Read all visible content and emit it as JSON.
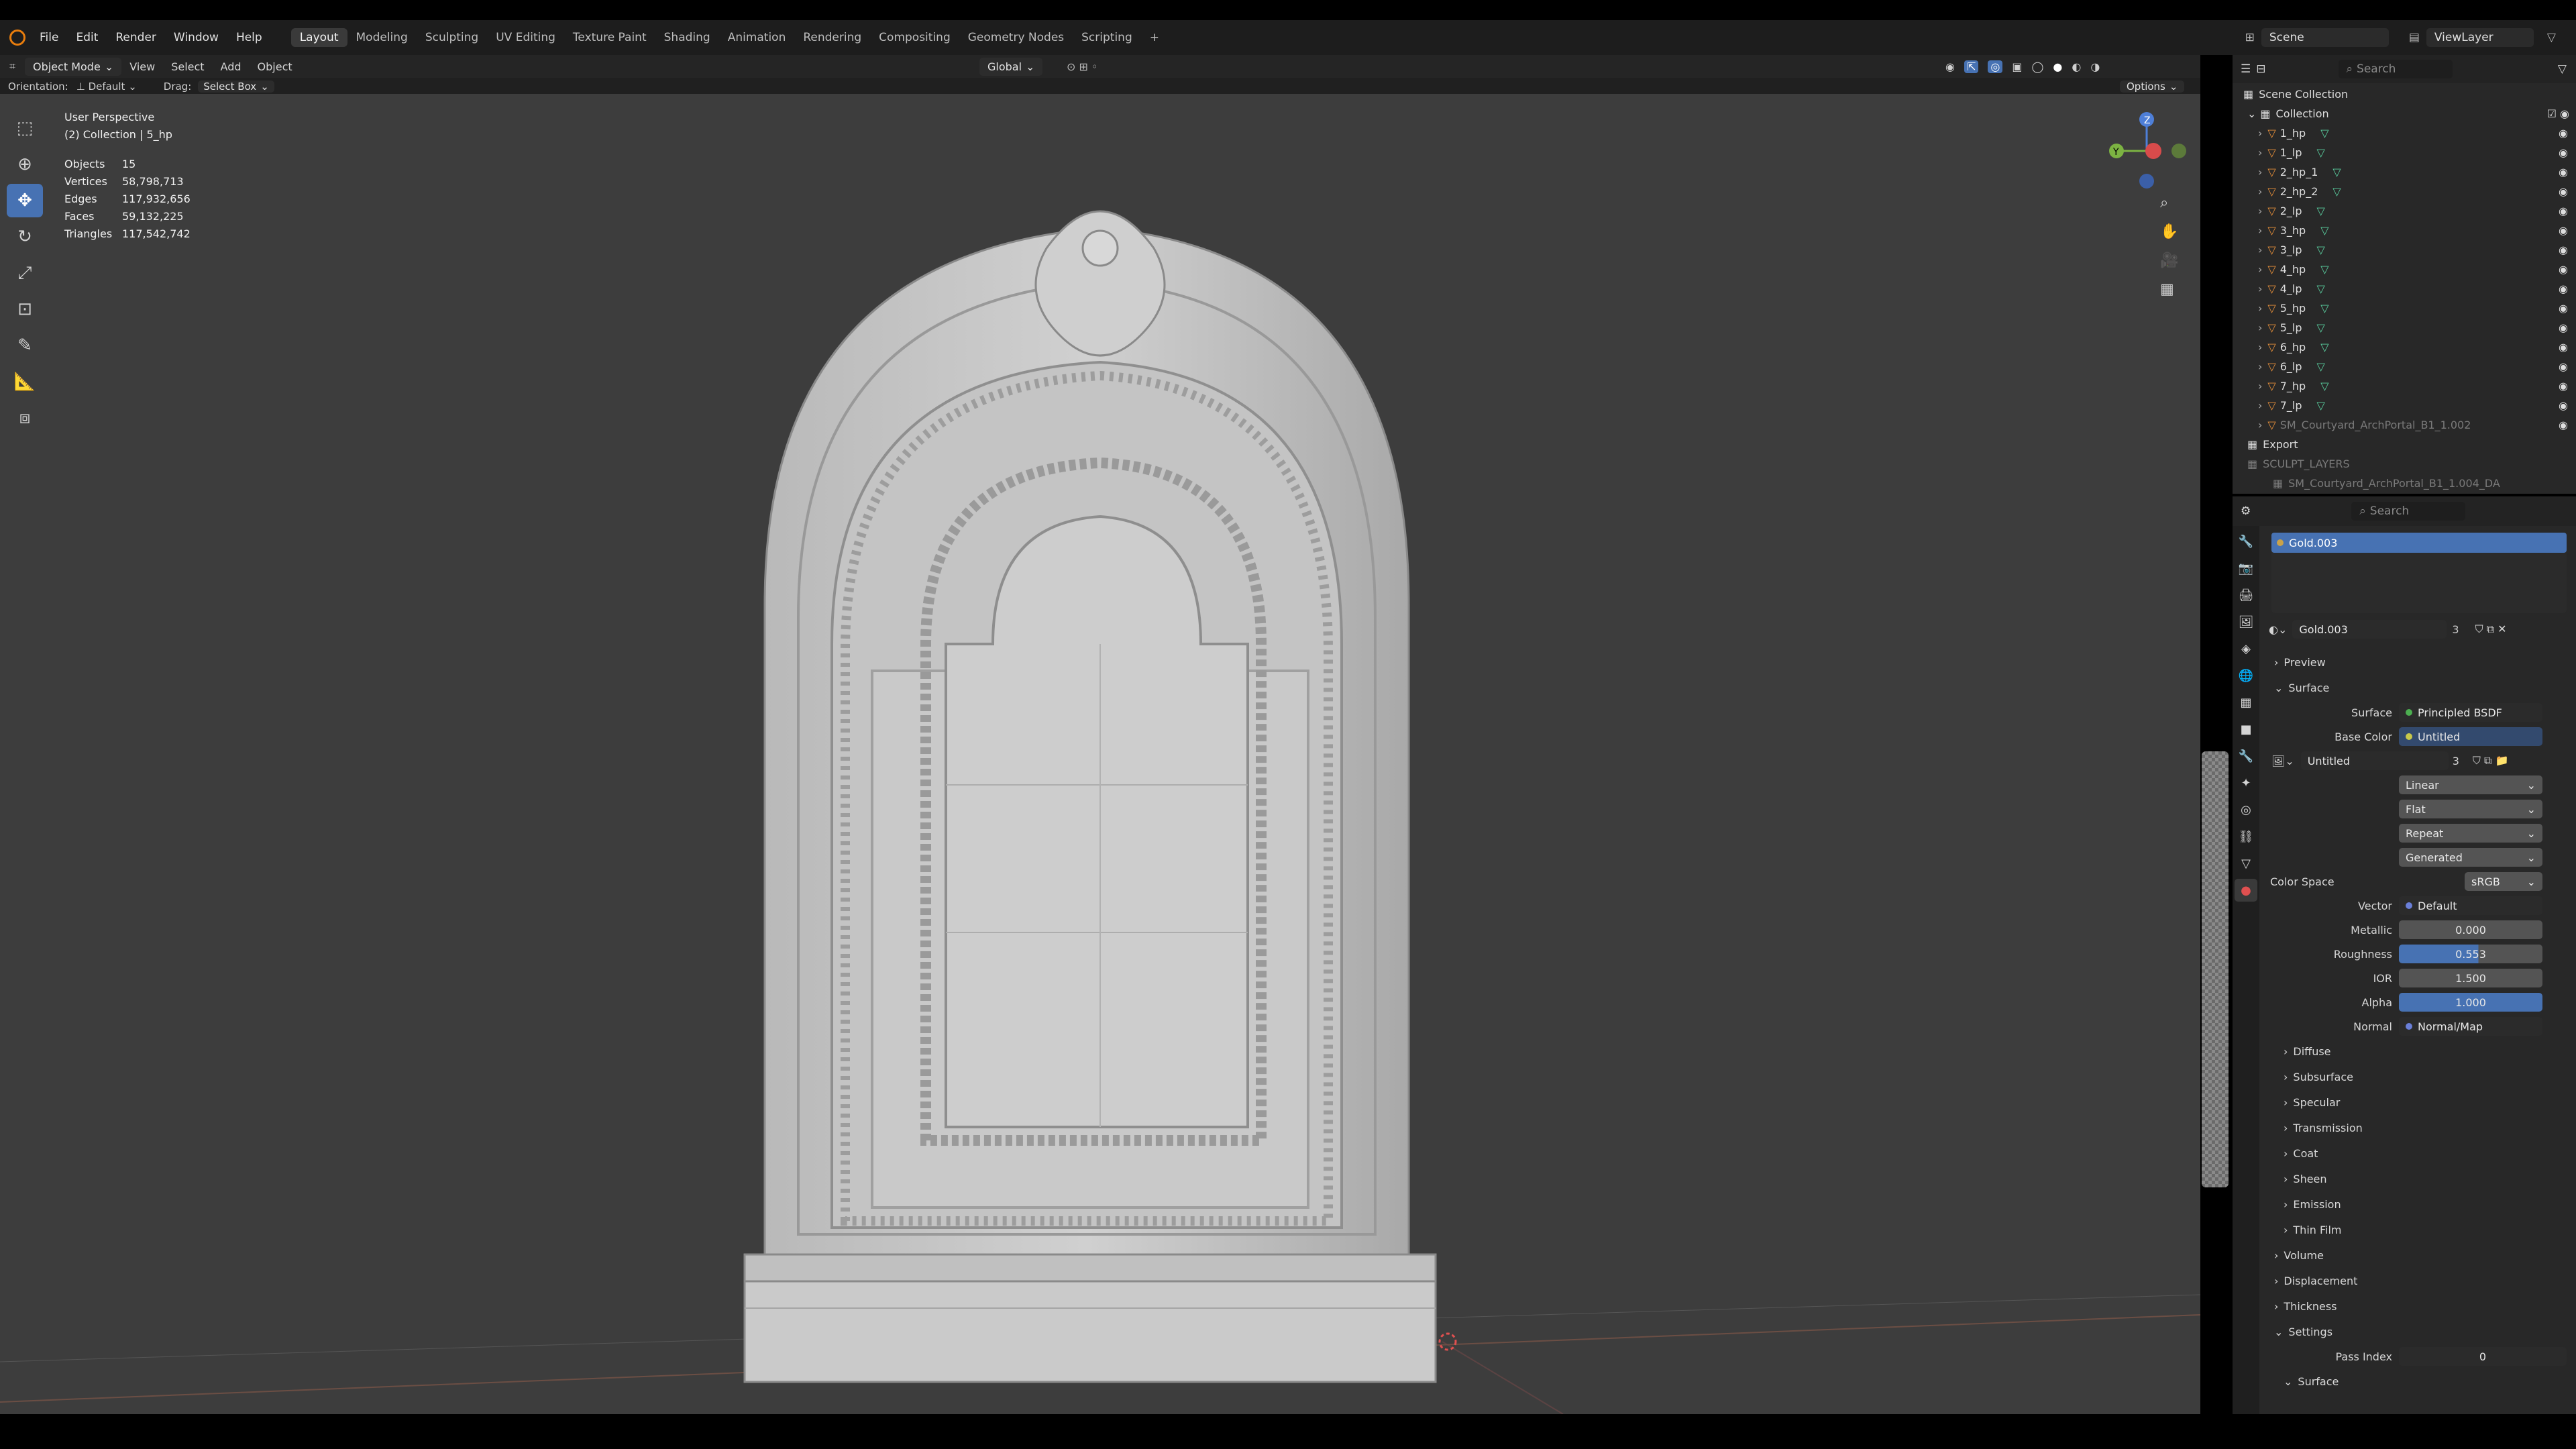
{
  "topbar": {
    "menus": [
      "File",
      "Edit",
      "Render",
      "Window",
      "Help"
    ],
    "workspaces": [
      "Layout",
      "Modeling",
      "Sculpting",
      "UV Editing",
      "Texture Paint",
      "Shading",
      "Animation",
      "Rendering",
      "Compositing",
      "Geometry Nodes",
      "Scripting"
    ],
    "active_workspace": "Layout",
    "add": "+",
    "scene": "Scene",
    "viewlayer": "ViewLayer"
  },
  "header": {
    "mode": "Object Mode",
    "view": "View",
    "select": "Select",
    "add": "Add",
    "object": "Object",
    "transform": "Global",
    "options": "Options",
    "orientation_label": "Orientation:",
    "orientation": "Default",
    "drag_label": "Drag:",
    "drag": "Select Box"
  },
  "viewport": {
    "perspective": "User Perspective",
    "collection": "(2) Collection | 5_hp",
    "stats": [
      {
        "k": "Objects",
        "v": "15"
      },
      {
        "k": "Vertices",
        "v": "58,798,713"
      },
      {
        "k": "Edges",
        "v": "117,932,656"
      },
      {
        "k": "Faces",
        "v": "59,132,225"
      },
      {
        "k": "Triangles",
        "v": "117,542,742"
      }
    ],
    "gizmo": {
      "z": "Z",
      "y": "Y"
    }
  },
  "outliner": {
    "search_placeholder": "Search",
    "root": "Scene Collection",
    "collection": "Collection",
    "items": [
      "1_hp",
      "1_lp",
      "2_hp_1",
      "2_hp_2",
      "2_lp",
      "3_hp",
      "3_lp",
      "4_hp",
      "4_lp",
      "5_hp",
      "5_lp",
      "6_hp",
      "6_lp",
      "7_hp",
      "7_lp",
      "SM_Courtyard_ArchPortal_B1_1.002"
    ],
    "export": "Export",
    "sculpt": "SCULPT_LAYERS",
    "sculpt_item": "SM_Courtyard_ArchPortal_B1_1.004_DA"
  },
  "props": {
    "search_placeholder": "Search",
    "slot": "Gold.003",
    "material": "Gold.003",
    "users": "3",
    "preview": "Preview",
    "surface_section": "Surface",
    "surface_label": "Surface",
    "surface_value": "Principled BSDF",
    "basecolor_label": "Base Color",
    "basecolor_value": "Untitled",
    "image": "Untitled",
    "image_users": "3",
    "interp": "Linear",
    "proj": "Flat",
    "ext": "Repeat",
    "source": "Generated",
    "colorspace_label": "Color Space",
    "colorspace": "sRGB",
    "vector_label": "Vector",
    "vector": "Default",
    "metallic_label": "Metallic",
    "metallic": "0.000",
    "roughness_label": "Roughness",
    "roughness": "0.553",
    "roughness_value": 0.553,
    "ior_label": "IOR",
    "ior": "1.500",
    "alpha_label": "Alpha",
    "alpha": "1.000",
    "alpha_value": 1.0,
    "normal_label": "Normal",
    "normal": "Normal/Map",
    "subsections": [
      "Diffuse",
      "Subsurface",
      "Specular",
      "Transmission",
      "Coat",
      "Sheen",
      "Emission",
      "Thin Film"
    ],
    "volume": "Volume",
    "displacement": "Displacement",
    "thickness": "Thickness",
    "settings": "Settings",
    "pass_index_label": "Pass Index",
    "pass_index": "0",
    "surface2": "Surface"
  }
}
